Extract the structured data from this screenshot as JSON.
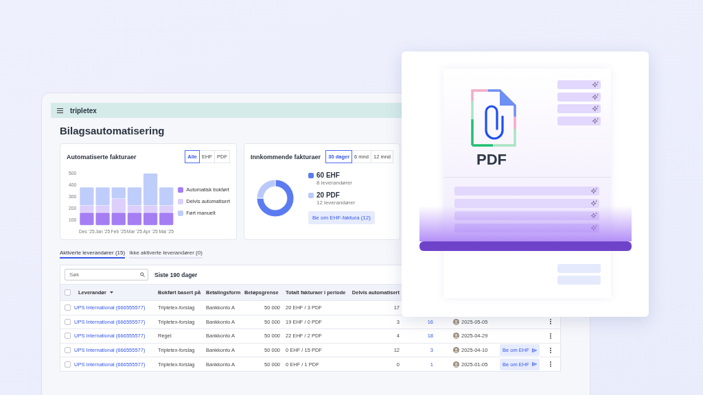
{
  "app": {
    "logo": "tripletex",
    "title": "Bilagsautomatisering"
  },
  "automated_card": {
    "title": "Automatiserte fakturaer",
    "filters": [
      {
        "label": "Alle",
        "selected": true
      },
      {
        "label": "EHF",
        "selected": false
      },
      {
        "label": "PDF",
        "selected": false
      }
    ],
    "chart_data": {
      "type": "bar",
      "stacked": true,
      "categories": [
        "Dec '25",
        "Jan '25",
        "Feb '25",
        "Mar '25",
        "Apr '25",
        "Mai '25"
      ],
      "ylim": [
        50,
        520
      ],
      "yticks": [
        100,
        200,
        300,
        400,
        500
      ],
      "series": [
        {
          "name": "Automatisk bokført",
          "color": "#a57ef3",
          "values": [
            160,
            160,
            160,
            160,
            160,
            160
          ]
        },
        {
          "name": "Delvis automatisert",
          "color": "#ddcffb",
          "values": [
            60,
            60,
            120,
            60,
            60,
            60
          ]
        },
        {
          "name": "Ført manuelt",
          "color": "#bfcdfa",
          "values": [
            160,
            160,
            100,
            160,
            280,
            160
          ]
        }
      ]
    }
  },
  "incoming_card": {
    "title": "Innkommende fakturaer",
    "filters": [
      {
        "label": "30 dager",
        "selected": true
      },
      {
        "label": "6 mnd",
        "selected": false
      },
      {
        "label": "12 mnd",
        "selected": false
      }
    ],
    "chart_data": {
      "type": "donut",
      "values": [
        75,
        25
      ]
    },
    "summary": [
      {
        "value": "60 EHF",
        "note": "8 leverandører",
        "color": "#5b7cf0"
      },
      {
        "value": "20 PDF",
        "note": "12 leverandører",
        "color": "#bac9fa"
      }
    ],
    "button": "Be om EHF-faktura (12)"
  },
  "tabs": [
    {
      "label": "Aktiverte leverandører (15)",
      "selected": true
    },
    {
      "label": "Ikke aktiverte leverandører (0)",
      "selected": false
    }
  ],
  "table": {
    "search": {
      "placeholder": "Søk"
    },
    "period": "Siste 190 dager",
    "all_checked": false,
    "columns": [
      "Leverandør",
      "Bokført basert på",
      "Betalingsform",
      "Beløpsgrense",
      "Totalt fakturaer i periode",
      "Delvis automatisert"
    ],
    "rows": [
      {
        "checked": false,
        "supplier": "UPS International (666555577)",
        "booked_by": "Tripletex-forslag",
        "payment": "Bankkonto A",
        "limit": "50 000",
        "totals": "20 EHF / 3 PDF",
        "partial": "17"
      },
      {
        "checked": false,
        "supplier": "UPS International (666555577)",
        "booked_by": "Tripletex-forslag",
        "payment": "Bankkonto A",
        "limit": "50 000",
        "totals": "19 EHF / 0 PDF",
        "partial": "3",
        "column_7": "16",
        "column_8": "2025-05-05"
      },
      {
        "checked": false,
        "supplier": "UPS International (666555577)",
        "booked_by": "Regel",
        "payment": "Bankkonto A",
        "limit": "50 000",
        "totals": "22 EHF / 2 PDF",
        "partial": "4",
        "column_7": "18",
        "column_8": "2025-04-29"
      },
      {
        "checked": false,
        "supplier": "UPS International (666555577)",
        "booked_by": "Tripletex-forslag",
        "payment": "Bankkonto A",
        "limit": "50 000",
        "totals": "0 EHF / 15 PDF",
        "partial": "12",
        "column_7": "3",
        "column_8": "2025-04-10",
        "action": "Be om EHF"
      },
      {
        "checked": false,
        "supplier": "UPS International (666555577)",
        "booked_by": "Tripletex-forslag",
        "payment": "Bankkonto A",
        "limit": "50 000",
        "totals": "0 EHF / 1 PDF",
        "partial": "0",
        "column_7": "1",
        "column_8": "2025-01-05",
        "action": "Be om EHF"
      }
    ]
  },
  "document_card": {
    "label": "PDF"
  }
}
